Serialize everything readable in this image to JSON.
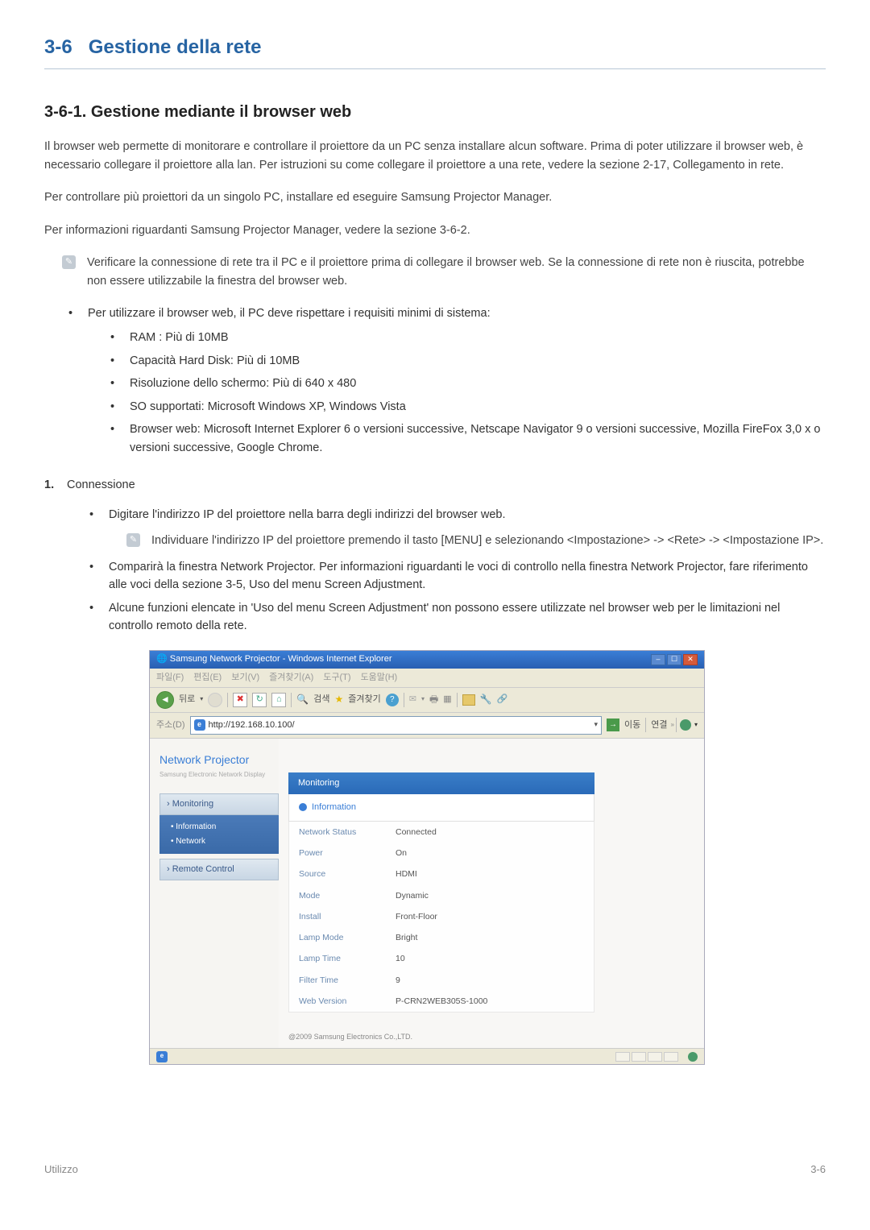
{
  "section": {
    "number": "3-6",
    "title": "Gestione della rete"
  },
  "subsection": {
    "number": "3-6-1.",
    "title": "Gestione mediante il browser web"
  },
  "p1": "Il browser web permette di monitorare e controllare il proiettore da un PC senza installare alcun software. Prima di poter utilizzare il browser web, è necessario collegare il proiettore alla lan. Per istruzioni su come collegare il proiettore a una rete, vedere la sezione 2-17, Collegamento in rete.",
  "p2": "Per controllare più proiettori da un singolo PC, installare ed eseguire Samsung Projector Manager.",
  "p3": "Per informazioni riguardanti Samsung Projector Manager, vedere la sezione 3-6-2.",
  "note1": "Verificare la connessione di rete tra il PC e il proiettore prima di collegare il browser web. Se la connessione di rete non è riuscita, potrebbe non essere utilizzabile la finestra del browser web.",
  "req_intro": "Per utilizzare il browser web, il PC deve rispettare i requisiti minimi di sistema:",
  "req": {
    "ram": "RAM : Più di 10MB",
    "hdd": "Capacità Hard Disk: Più di 10MB",
    "res": "Risoluzione dello schermo: Più di 640 x 480",
    "os": "SO supportati: Microsoft Windows XP, Windows Vista",
    "browser": "Browser web: Microsoft Internet Explorer 6 o versioni successive, Netscape Navigator 9 o versioni successive, Mozilla FireFox 3,0 x o versioni successive, Google Chrome."
  },
  "step1_label": "1.",
  "step1_title": "Connessione",
  "step1_a": "Digitare l'indirizzo IP del proiettore nella barra degli indirizzi del browser web.",
  "step1_note": "Individuare l'indirizzo IP del proiettore premendo il tasto [MENU] e selezionando <Impostazione> -> <Rete> -> <Impostazione IP>.",
  "step1_b": "Comparirà la finestra Network Projector. Per informazioni riguardanti le voci di controllo nella finestra Network Projector, fare riferimento alle voci della sezione 3-5, Uso del menu Screen Adjustment.",
  "step1_c": "Alcune funzioni elencate in 'Uso del menu Screen Adjustment' non possono essere utilizzate nel browser web per le limitazioni nel controllo remoto della rete.",
  "ie": {
    "title": "Samsung Network Projector - Windows Internet Explorer",
    "menu": {
      "m1": "파일(F)",
      "m2": "편집(E)",
      "m3": "보기(V)",
      "m4": "즐겨찾기(A)",
      "m5": "도구(T)",
      "m6": "도움말(H)"
    },
    "back_label": "뒤로",
    "search_label": "검색",
    "fav_label": "즐겨찾기",
    "addr_label": "주소(D)",
    "url": "http://192.168.10.100/",
    "go_label": "이동",
    "links_label": "연결",
    "status_done": ""
  },
  "np": {
    "logo": "Network Projector",
    "logo_sub": "Samsung Electronic Network Display",
    "menu_monitoring": "› Monitoring",
    "menu_info": "• Information",
    "menu_network": "• Network",
    "menu_remote": "› Remote Control",
    "hdr_monitoring": "Monitoring",
    "hdr_info": "Information",
    "rows": {
      "network_status_k": "Network Status",
      "network_status_v": "Connected",
      "power_k": "Power",
      "power_v": "On",
      "source_k": "Source",
      "source_v": "HDMI",
      "mode_k": "Mode",
      "mode_v": "Dynamic",
      "install_k": "Install",
      "install_v": "Front-Floor",
      "lamp_mode_k": "Lamp Mode",
      "lamp_mode_v": "Bright",
      "lamp_time_k": "Lamp Time",
      "lamp_time_v": "10",
      "filter_time_k": "Filter Time",
      "filter_time_v": "9",
      "web_version_k": "Web Version",
      "web_version_v": "P-CRN2WEB305S-1000"
    },
    "copyright": "@2009 Samsung Electronics Co.,LTD."
  },
  "footer": {
    "left": "Utilizzo",
    "right": "3-6"
  }
}
